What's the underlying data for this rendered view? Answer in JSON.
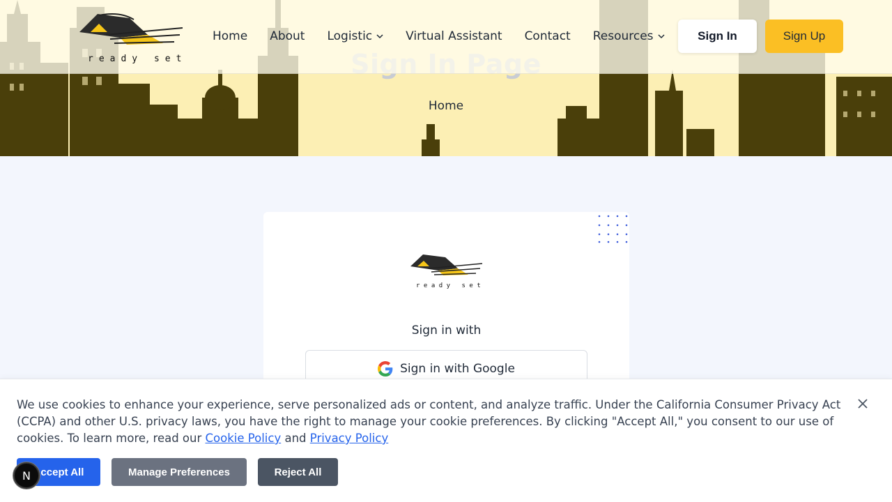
{
  "brand": {
    "logo_text": "ready set"
  },
  "nav": {
    "items": [
      {
        "label": "Home",
        "has_dropdown": false
      },
      {
        "label": "About",
        "has_dropdown": false
      },
      {
        "label": "Logistic",
        "has_dropdown": true
      },
      {
        "label": "Virtual Assistant",
        "has_dropdown": false
      },
      {
        "label": "Contact",
        "has_dropdown": false
      },
      {
        "label": "Resources",
        "has_dropdown": true
      }
    ],
    "signin_label": "Sign In",
    "signup_label": "Sign Up"
  },
  "hero": {
    "title": "Sign In Page",
    "breadcrumb": "Home"
  },
  "card": {
    "signin_with": "Sign in with",
    "google_label": "Sign in with Google"
  },
  "cookie": {
    "text_before": "We use cookies to enhance your experience, serve personalized ads or content, and analyze traffic. Under the California Consumer Privacy Act (CCPA) and other U.S. privacy laws, you have the right to manage your cookie preferences. By clicking \"Accept All,\" you consent to our use of cookies. To learn more, read our ",
    "cookie_policy_link": "Cookie Policy",
    "and_text": " and ",
    "privacy_policy_link": "Privacy Policy",
    "accept_label": "Accept All",
    "manage_label": "Manage Preferences",
    "reject_label": "Reject All"
  },
  "badge": {
    "letter": "N"
  },
  "colors": {
    "accent_yellow": "#fbbf24",
    "hero_bg": "#fcefb4",
    "skyline": "#4a3f0a",
    "primary_blue": "#2563eb"
  }
}
